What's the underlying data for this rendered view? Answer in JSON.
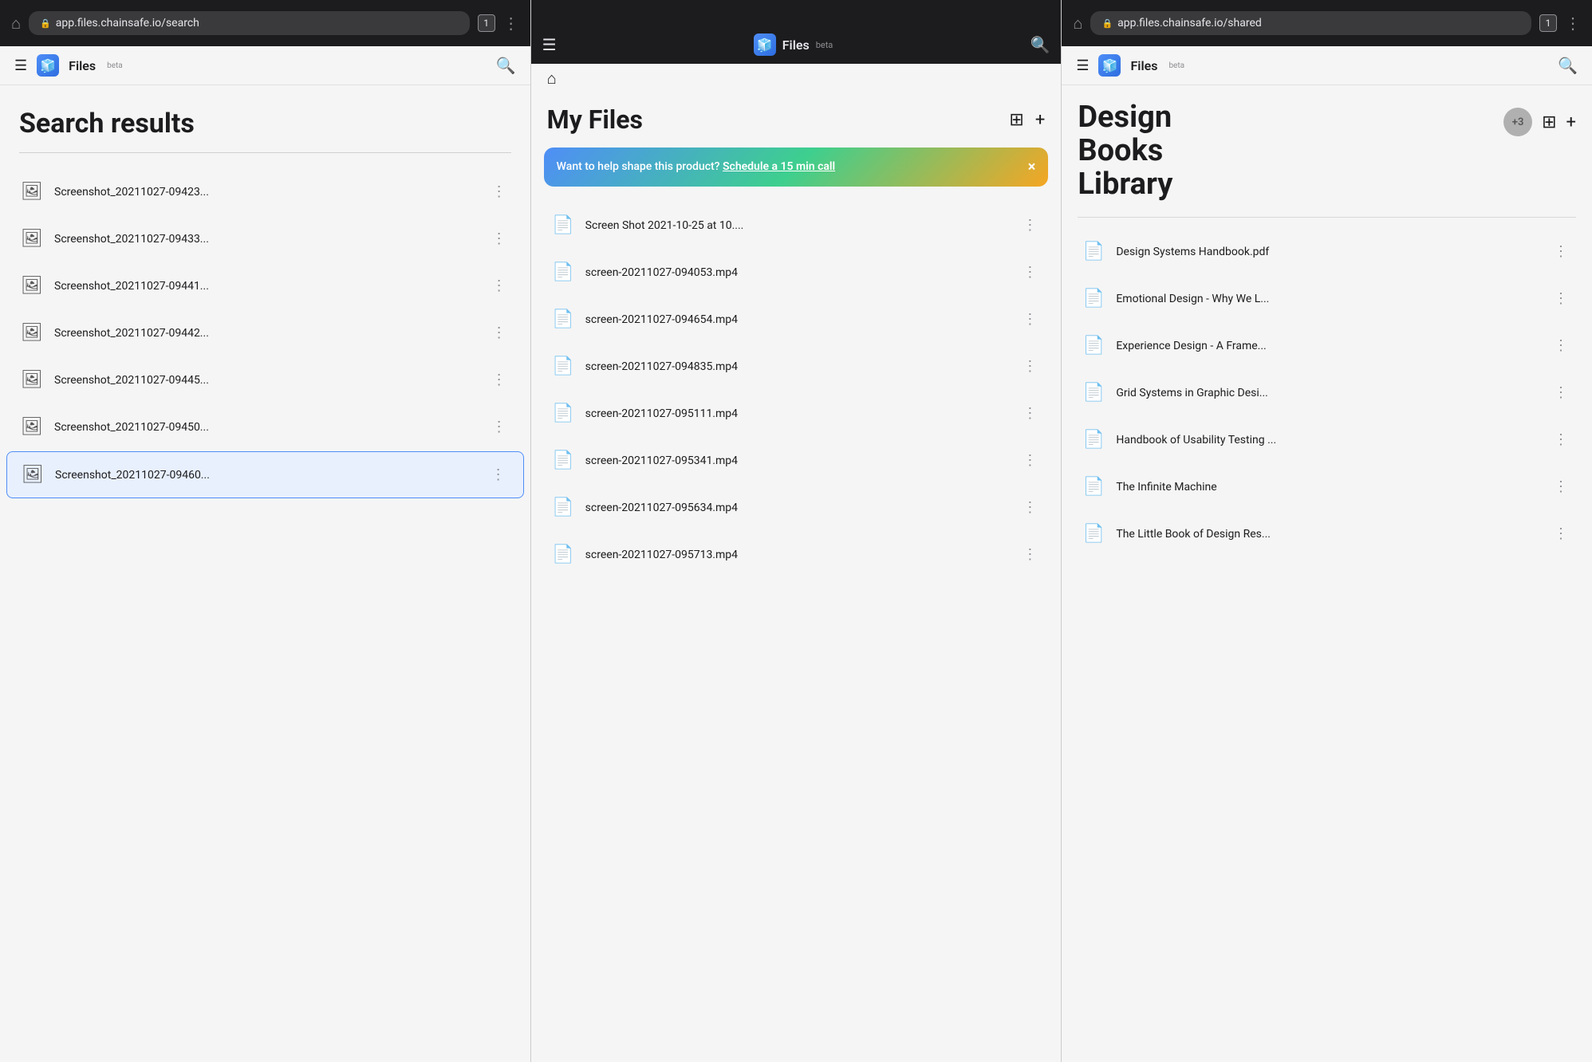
{
  "panels": {
    "search": {
      "browser": {
        "address": "app.files.chainsafe.io/search",
        "tab_number": "1"
      },
      "app_title": "Files",
      "app_beta": "beta",
      "heading": "Search results",
      "files": [
        {
          "name": "Screenshot_20211027-09423...",
          "type": "image"
        },
        {
          "name": "Screenshot_20211027-09433...",
          "type": "image"
        },
        {
          "name": "Screenshot_20211027-09441...",
          "type": "image"
        },
        {
          "name": "Screenshot_20211027-09442...",
          "type": "image"
        },
        {
          "name": "Screenshot_20211027-09445...",
          "type": "image"
        },
        {
          "name": "Screenshot_20211027-09450...",
          "type": "image"
        },
        {
          "name": "Screenshot_20211027-09460...",
          "type": "image",
          "selected": true
        }
      ]
    },
    "myfiles": {
      "app_title": "Files",
      "app_beta": "beta",
      "page_title": "My Files",
      "banner": {
        "text": "Want to help shape this product?",
        "link_text": "Schedule a 15 min call",
        "close": "×"
      },
      "files": [
        {
          "name": "Screen Shot 2021-10-25 at 10....",
          "type": "file"
        },
        {
          "name": "screen-20211027-094053.mp4",
          "type": "file"
        },
        {
          "name": "screen-20211027-094654.mp4",
          "type": "file"
        },
        {
          "name": "screen-20211027-094835.mp4",
          "type": "file"
        },
        {
          "name": "screen-20211027-095111.mp4",
          "type": "file"
        },
        {
          "name": "screen-20211027-095341.mp4",
          "type": "file"
        },
        {
          "name": "screen-20211027-095634.mp4",
          "type": "file"
        },
        {
          "name": "screen-20211027-095713.mp4",
          "type": "file"
        }
      ]
    },
    "library": {
      "browser": {
        "address": "app.files.chainsafe.io/shared",
        "tab_number": "1"
      },
      "app_title": "Files",
      "app_beta": "beta",
      "page_title_line1": "Design",
      "page_title_line2": "Books",
      "page_title_line3": "Library",
      "avatar_count": "+3",
      "files": [
        {
          "name": "Design Systems Handbook.pdf",
          "type": "pdf"
        },
        {
          "name": "Emotional Design - Why We L...",
          "type": "pdf"
        },
        {
          "name": "Experience Design - A Frame...",
          "type": "pdf"
        },
        {
          "name": "Grid Systems in Graphic Desi...",
          "type": "pdf"
        },
        {
          "name": "Handbook of Usability Testing ...",
          "type": "pdf"
        },
        {
          "name": "The Infinite Machine",
          "type": "file"
        },
        {
          "name": "The Little Book of Design Res...",
          "type": "pdf"
        }
      ]
    }
  },
  "icons": {
    "hamburger": "☰",
    "home": "⌂",
    "search": "🔍",
    "grid": "⊞",
    "plus": "+",
    "more": "⋮",
    "close": "×",
    "lock": "🔒",
    "file_image": "🖼",
    "file_generic": "📄",
    "file_pdf": "📄"
  }
}
